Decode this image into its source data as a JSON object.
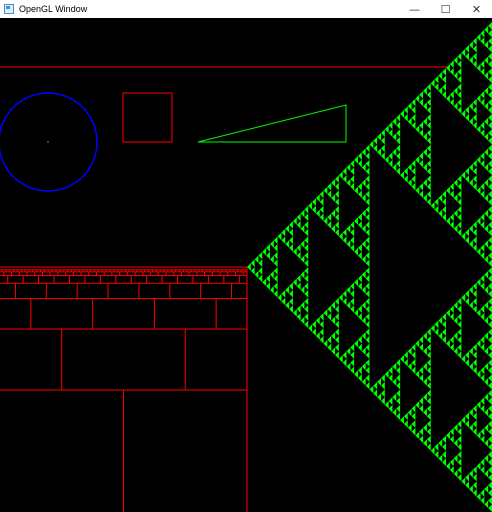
{
  "window": {
    "title": "OpenGL Window",
    "icon": "opengl-app-icon",
    "controls": {
      "minimize": "—",
      "maximize": "☐",
      "close": "✕"
    }
  },
  "canvas": {
    "background": "#000000"
  },
  "colors": {
    "line": "#ff0000",
    "circle": "#0000ff",
    "triangle": "#00ff00",
    "fractal": "#00ff00",
    "center_point": "#ffffff"
  }
}
